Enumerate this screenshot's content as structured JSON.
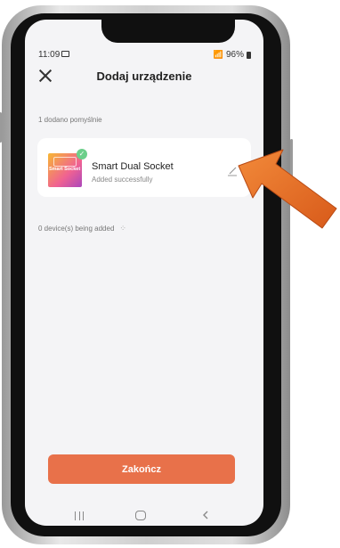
{
  "status_bar": {
    "time": "11:09",
    "battery": "96%"
  },
  "header": {
    "title": "Dodaj urządzenie"
  },
  "success_count": "1 dodano pomyślnie",
  "device": {
    "name": "Smart Dual Socket",
    "status": "Added successfully",
    "thumbnail_text": "Smart Socket"
  },
  "adding_status": "0 device(s) being added",
  "finish_button": {
    "label": "Zakończ"
  },
  "colors": {
    "accent": "#e8714a",
    "success": "#6ccf8a",
    "arrow": "#e8702a"
  },
  "icons": {
    "close": "close-icon",
    "edit": "edit-pencil-icon",
    "check": "check-badge-icon",
    "arrow": "pointer-arrow-icon"
  }
}
